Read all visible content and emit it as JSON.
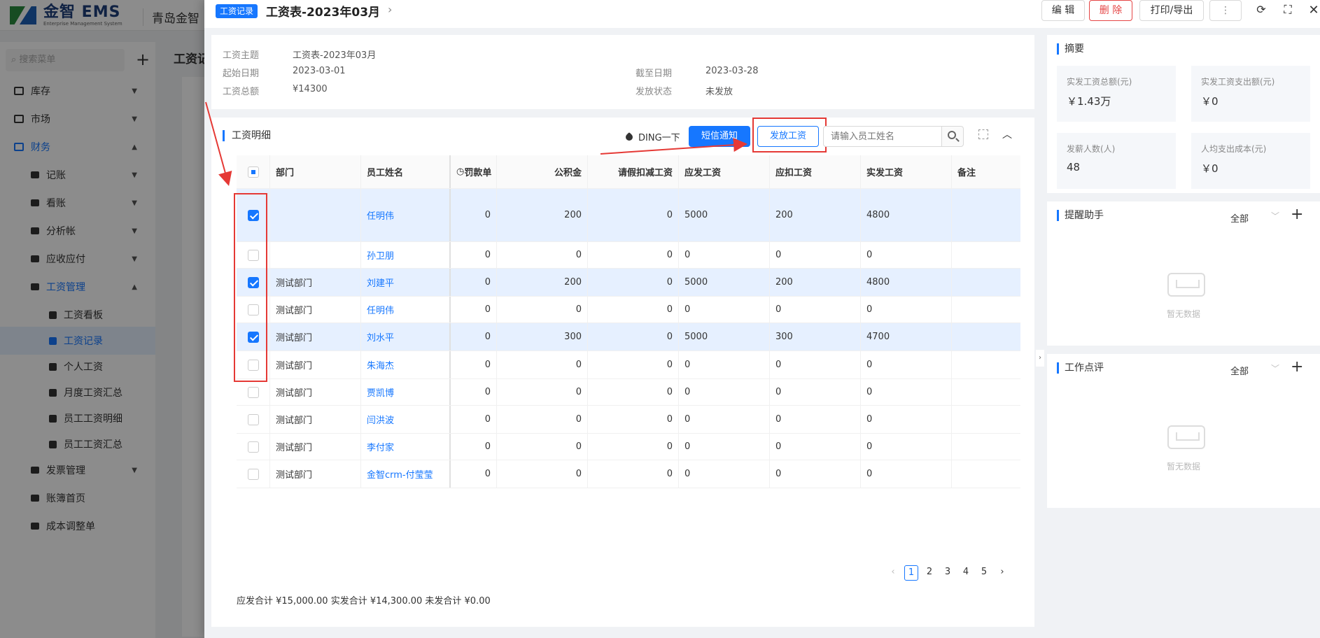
{
  "app": {
    "logo_text": "金智 EMS",
    "logo_sub": "Enterprise Management System",
    "company": "青岛金智",
    "menu_search_placeholder": "搜索菜单",
    "bg_page_title": "工资记",
    "menu": [
      {
        "label": "库存",
        "level": 0,
        "state": "collapsed"
      },
      {
        "label": "市场",
        "level": 0,
        "state": "collapsed"
      },
      {
        "label": "财务",
        "level": 0,
        "state": "expanded"
      },
      {
        "label": "记账",
        "level": 1,
        "state": "collapsed"
      },
      {
        "label": "看账",
        "level": 1,
        "state": "collapsed"
      },
      {
        "label": "分析帐",
        "level": 1,
        "state": "collapsed"
      },
      {
        "label": "应收应付",
        "level": 1,
        "state": "collapsed"
      },
      {
        "label": "工资管理",
        "level": 1,
        "state": "expanded"
      },
      {
        "label": "工资看板",
        "level": 2,
        "state": "leaf"
      },
      {
        "label": "工资记录",
        "level": 2,
        "state": "selected"
      },
      {
        "label": "个人工资",
        "level": 2,
        "state": "leaf"
      },
      {
        "label": "月度工资汇总",
        "level": 2,
        "state": "leaf"
      },
      {
        "label": "员工工资明细",
        "level": 2,
        "state": "leaf"
      },
      {
        "label": "员工工资汇总",
        "level": 2,
        "state": "leaf"
      },
      {
        "label": "发票管理",
        "level": 1,
        "state": "collapsed"
      },
      {
        "label": "账簿首页",
        "level": 1,
        "state": "leaf"
      },
      {
        "label": "成本调整单",
        "level": 1,
        "state": "leaf"
      }
    ]
  },
  "drawer": {
    "tag": "工资记录",
    "title": "工资表-2023年03月",
    "actions": {
      "edit": "编 辑",
      "delete": "删 除",
      "print": "打印/导出",
      "more": "⋮"
    },
    "info": {
      "subject_label": "工资主题",
      "subject": "工资表-2023年03月",
      "start_label": "起始日期",
      "start": "2023-03-01",
      "end_label": "截至日期",
      "end": "2023-03-28",
      "total_label": "工资总额",
      "total": "¥14300",
      "status_label": "发放状态",
      "status": "未发放"
    },
    "detail": {
      "title": "工资明细",
      "ding": "DING一下",
      "sms_button": "短信通知",
      "pay_button": "发放工资",
      "search_placeholder": "请输入员工姓名",
      "columns": [
        "部门",
        "员工姓名",
        "罚款单",
        "公积金",
        "请假扣减工资",
        "应发工资",
        "应扣工资",
        "实发工资",
        "备注"
      ],
      "rows": [
        {
          "checked": true,
          "dept": "",
          "name": "任明伟",
          "fine": "0",
          "fund": "200",
          "leave": "0",
          "due": "5000",
          "deduct": "200",
          "net": "4800",
          "note": ""
        },
        {
          "checked": false,
          "dept": "",
          "name": "孙卫朋",
          "fine": "0",
          "fund": "0",
          "leave": "0",
          "due": "0",
          "deduct": "0",
          "net": "0",
          "note": ""
        },
        {
          "checked": true,
          "dept": "测试部门",
          "name": "刘建平",
          "fine": "0",
          "fund": "200",
          "leave": "0",
          "due": "5000",
          "deduct": "200",
          "net": "4800",
          "note": ""
        },
        {
          "checked": false,
          "dept": "测试部门",
          "name": "任明伟",
          "fine": "0",
          "fund": "0",
          "leave": "0",
          "due": "0",
          "deduct": "0",
          "net": "0",
          "note": ""
        },
        {
          "checked": true,
          "dept": "测试部门",
          "name": "刘水平",
          "fine": "0",
          "fund": "300",
          "leave": "0",
          "due": "5000",
          "deduct": "300",
          "net": "4700",
          "note": ""
        },
        {
          "checked": false,
          "dept": "测试部门",
          "name": "朱海杰",
          "fine": "0",
          "fund": "0",
          "leave": "0",
          "due": "0",
          "deduct": "0",
          "net": "0",
          "note": ""
        },
        {
          "checked": false,
          "dept": "测试部门",
          "name": "贾凯博",
          "fine": "0",
          "fund": "0",
          "leave": "0",
          "due": "0",
          "deduct": "0",
          "net": "0",
          "note": ""
        },
        {
          "checked": false,
          "dept": "测试部门",
          "name": "闫洪波",
          "fine": "0",
          "fund": "0",
          "leave": "0",
          "due": "0",
          "deduct": "0",
          "net": "0",
          "note": ""
        },
        {
          "checked": false,
          "dept": "测试部门",
          "name": "李付家",
          "fine": "0",
          "fund": "0",
          "leave": "0",
          "due": "0",
          "deduct": "0",
          "net": "0",
          "note": ""
        },
        {
          "checked": false,
          "dept": "测试部门",
          "name": "金智crm-付莹莹",
          "fine": "0",
          "fund": "0",
          "leave": "0",
          "due": "0",
          "deduct": "0",
          "net": "0",
          "note": ""
        }
      ],
      "pages": [
        "1",
        "2",
        "3",
        "4",
        "5"
      ],
      "current_page": "1",
      "totals": "应发合计 ¥15,000.00 实发合计 ¥14,300.00 未发合计 ¥0.00"
    },
    "summary": {
      "title": "摘要",
      "stats": [
        {
          "label": "实发工资总额(元)",
          "value": "￥1.43万"
        },
        {
          "label": "实发工资支出额(元)",
          "value": "￥0"
        },
        {
          "label": "发薪人数(人)",
          "value": "48"
        },
        {
          "label": "人均支出成本(元)",
          "value": "￥0"
        }
      ]
    },
    "reminder": {
      "title": "提醒助手",
      "filter": "全部",
      "empty": "暂无数据"
    },
    "review": {
      "title": "工作点评",
      "filter": "全部",
      "empty": "暂无数据"
    }
  },
  "colors": {
    "primary": "#1677ff",
    "danger": "#e54545",
    "annotation": "#e53935"
  }
}
